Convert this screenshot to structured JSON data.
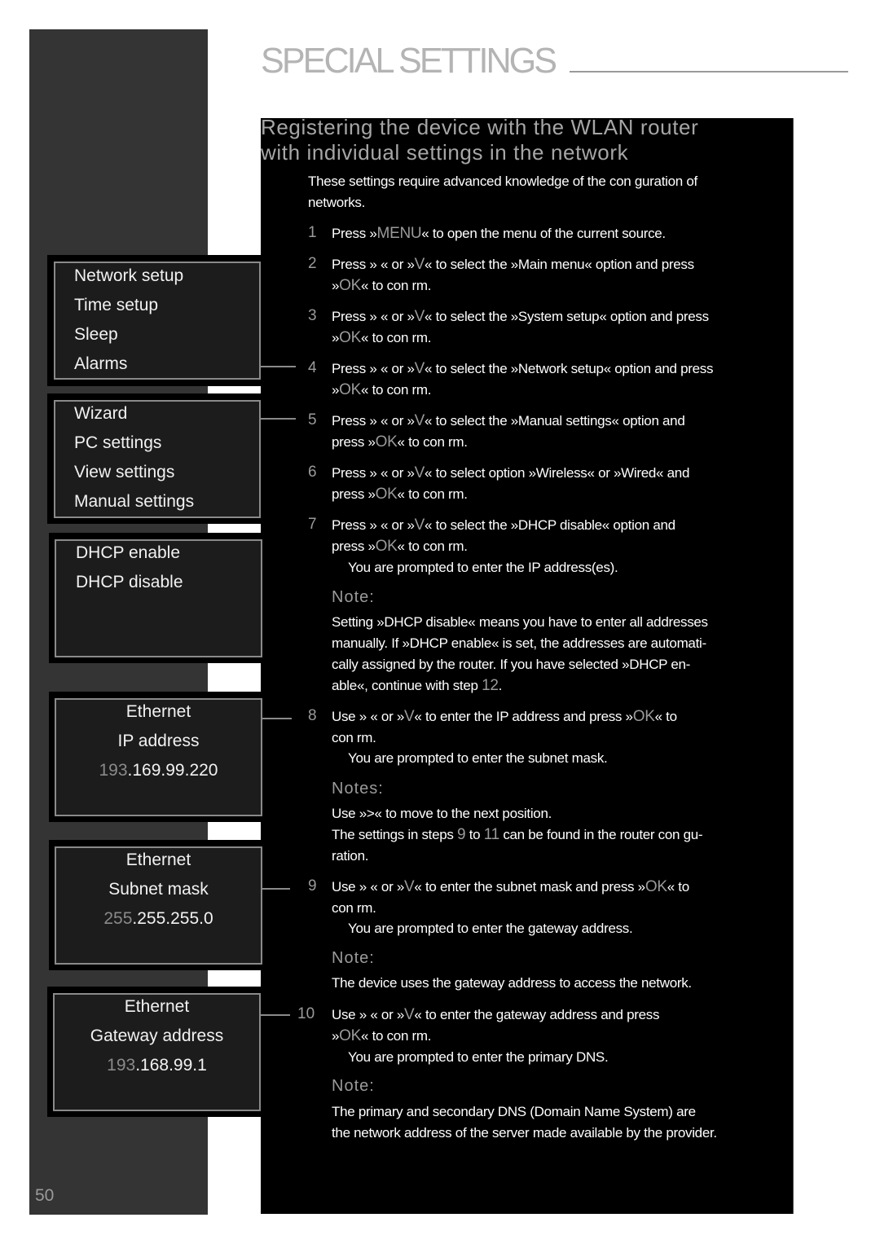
{
  "header": {
    "title": "SPECIAL SETTINGS",
    "page_number": "50"
  },
  "section": {
    "heading_line1": "Registering the device with the WLAN router",
    "heading_line2": "with individual settings in the network",
    "intro_line1": "These settings require advanced knowledge of the con  guration of",
    "intro_line2": "networks."
  },
  "steps": [
    {
      "num": "1",
      "lines": [
        "Press »MENU« to open the menu of the current source."
      ]
    },
    {
      "num": "2",
      "lines": [
        "Press »    « or »V« to select the »Main menu« option and press",
        "»OK« to con  rm."
      ]
    },
    {
      "num": "3",
      "lines": [
        "Press »    « or »V« to select the »System setup« option and press",
        "»OK« to con  rm."
      ]
    },
    {
      "num": "4",
      "lines": [
        "Press »    « or »V« to select the »Network setup« option and press",
        "»OK« to con  rm."
      ]
    },
    {
      "num": "5",
      "lines": [
        "Press »    « or »V« to select the »Manual settings« option and",
        "press »OK« to con  rm."
      ]
    },
    {
      "num": "6",
      "lines": [
        "Press »    « or »V« to select option »Wireless« or »Wired« and",
        "press »OK« to con  rm."
      ]
    },
    {
      "num": "7",
      "lines": [
        "Press »    « or »V« to select the »DHCP disable« option and",
        "press »OK« to con  rm."
      ],
      "result": "You are prompted to enter the IP address(es)."
    },
    {
      "num": "8",
      "lines": [
        "Use »    « or »V« to enter the IP address and press »OK« to",
        "con  rm."
      ],
      "result": "You are prompted to enter the subnet mask."
    },
    {
      "num": "9",
      "lines": [
        "Use »    « or »V« to enter the subnet mask and press »OK« to",
        "con  rm."
      ],
      "result": "You are prompted to enter the gateway address."
    },
    {
      "num": "10",
      "lines": [
        "Use »    « or »V« to enter the gateway address and press",
        "»OK« to con  rm."
      ],
      "result": "You are prompted to enter the primary DNS."
    }
  ],
  "notes": [
    {
      "label": "Note:",
      "lines": [
        "Setting »DHCP disable« means you have to enter all addresses",
        "manually. If »DHCP enable« is set, the addresses are automati-",
        "cally assigned by the router. If you have selected »DHCP en-",
        "able«, continue with step 12."
      ]
    },
    {
      "label": "Notes:",
      "lines": [
        "Use »>« to move to the next position.",
        "The settings in steps 9 to 11 can be found in the router con  gu-",
        "ration."
      ]
    },
    {
      "label": "Note:",
      "lines": [
        "The device uses the gateway address to access the network."
      ]
    },
    {
      "label": "Note:",
      "lines": [
        "The primary and secondary DNS (Domain Name System) are",
        "the network address of the server made available by the provider."
      ]
    }
  ],
  "screens": {
    "system_menu": [
      "Network setup",
      "Time setup",
      "Sleep",
      "Alarms"
    ],
    "network_menu": [
      "Wizard",
      "PC settings",
      "View settings",
      "Manual settings"
    ],
    "dhcp_menu": [
      "DHCP enable",
      "DHCP disable"
    ],
    "ip": {
      "title": "Ethernet",
      "label": "IP address",
      "value_active": "193",
      "value_rest": ".169.99.220"
    },
    "subnet": {
      "title": "Ethernet",
      "label": "Subnet mask",
      "value_active": "255",
      "value_rest": ".255.255.0"
    },
    "gateway": {
      "title": "Ethernet",
      "label": "Gateway address",
      "value_active": "193",
      "value_rest": ".168.99.1"
    }
  }
}
